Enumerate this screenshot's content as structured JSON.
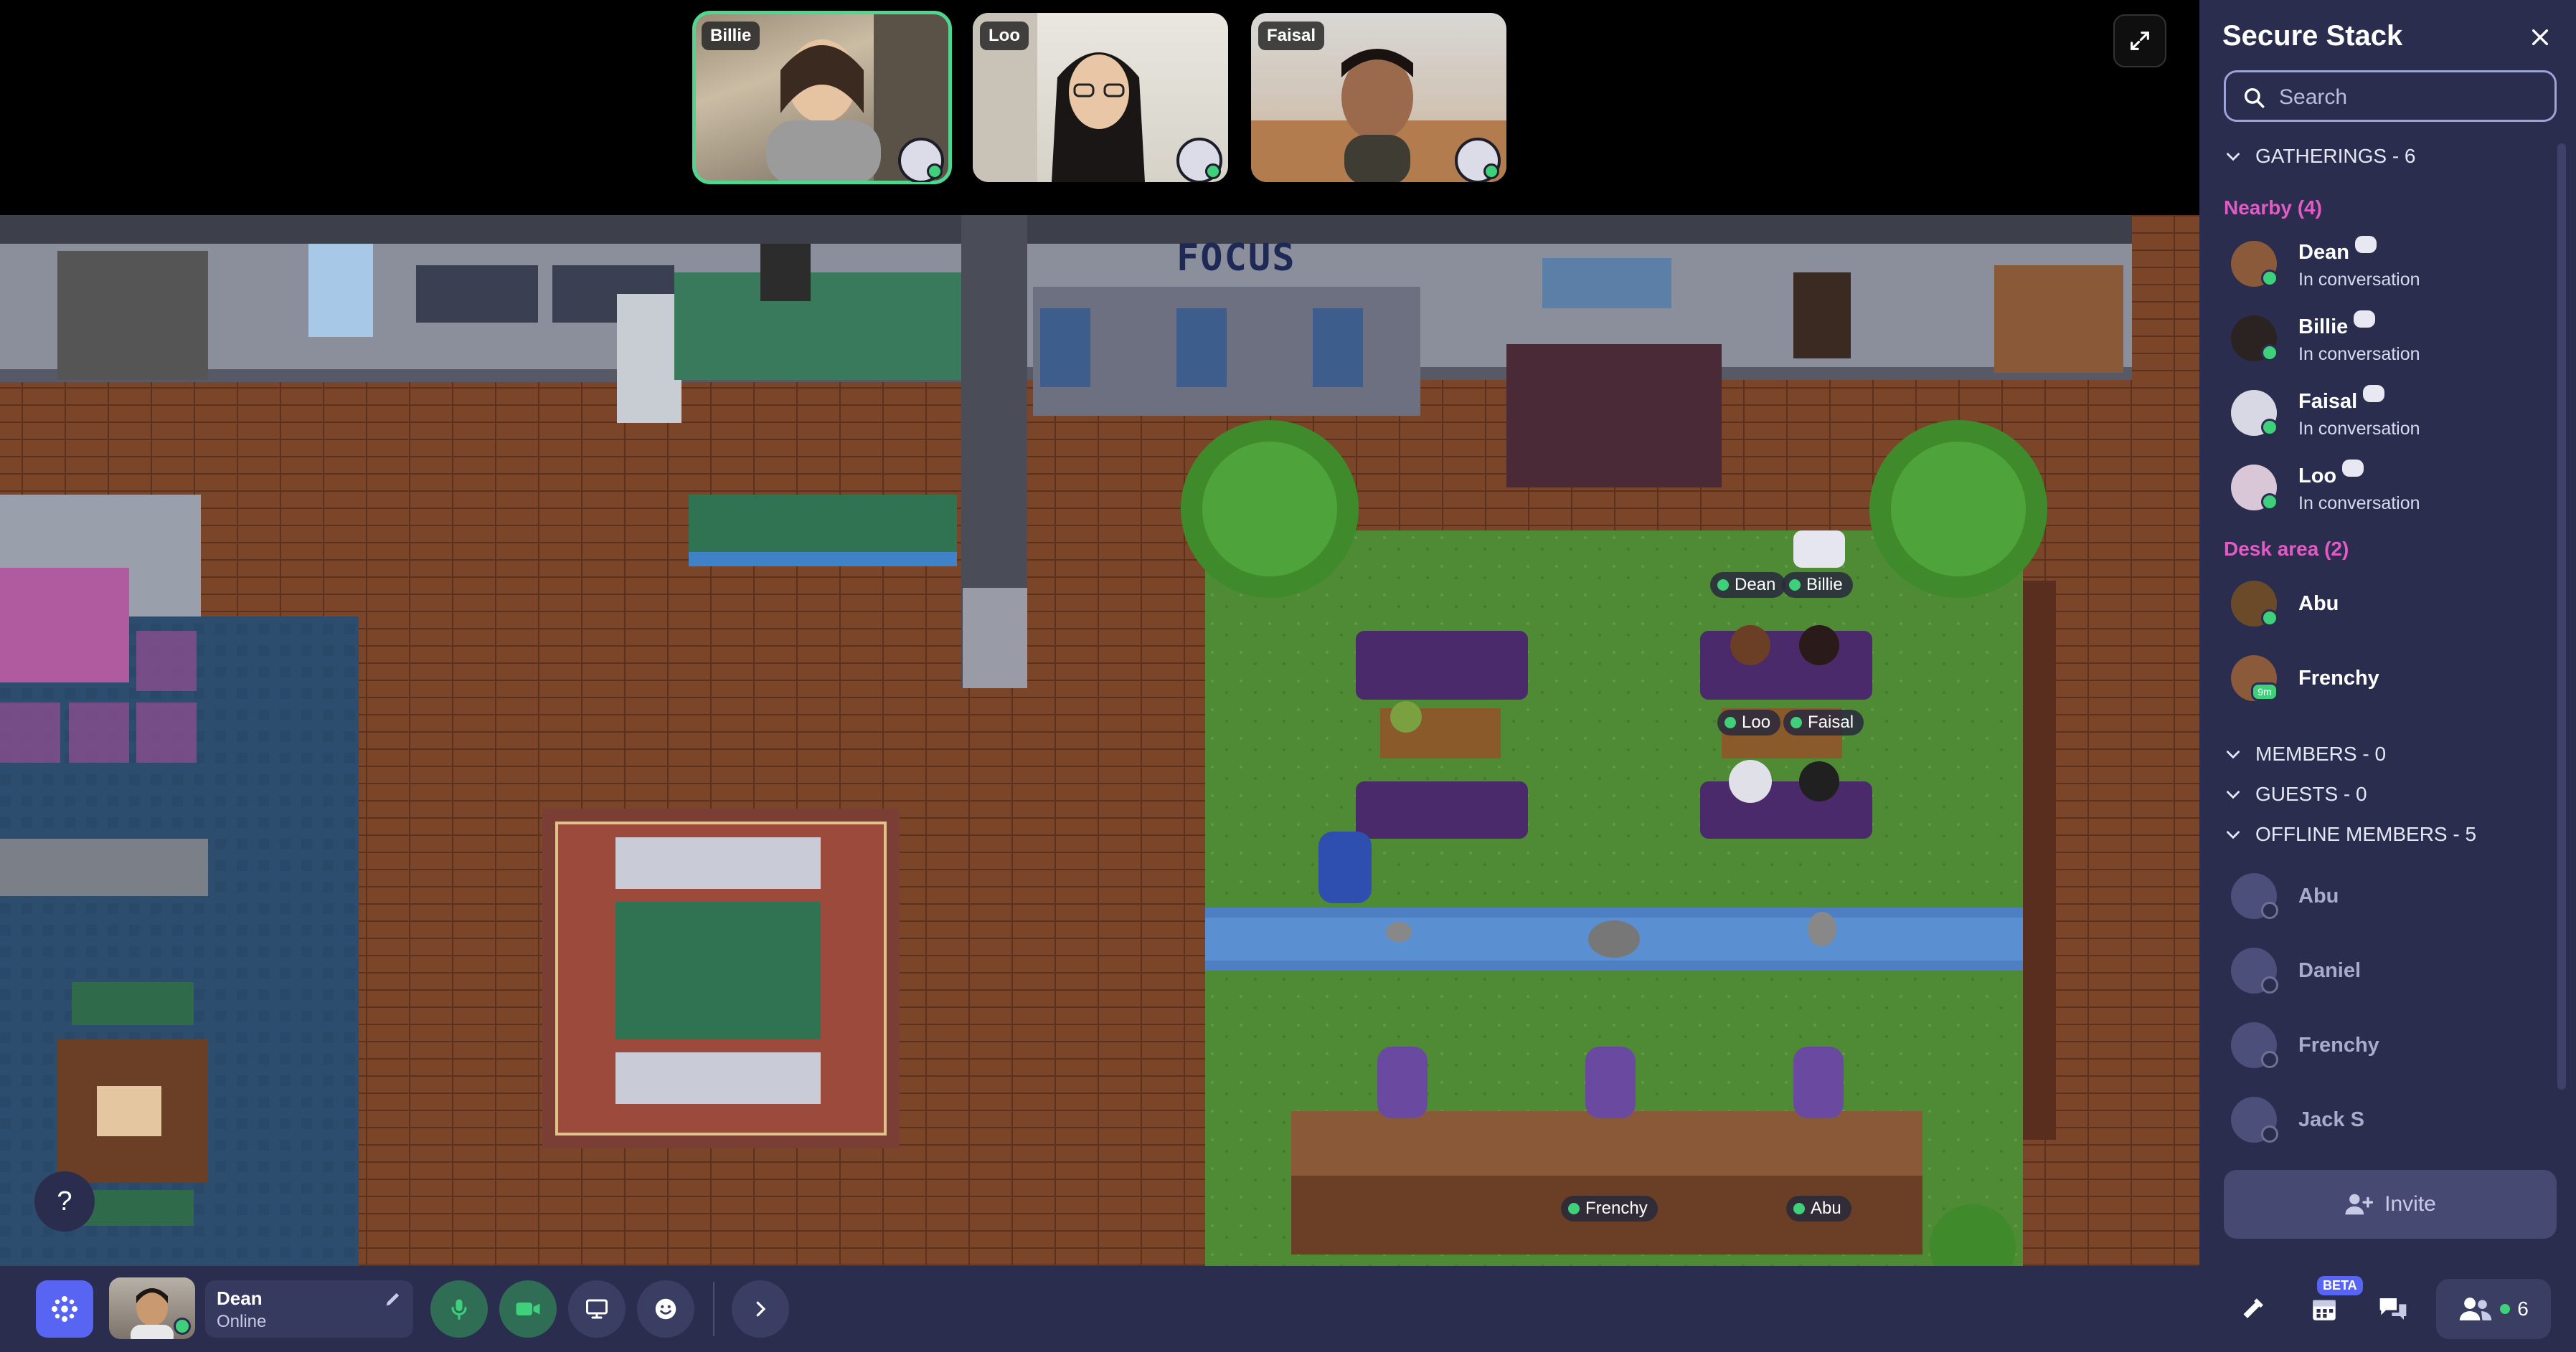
{
  "videos": [
    {
      "name": "Billie",
      "active": true
    },
    {
      "name": "Loo",
      "active": false
    },
    {
      "name": "Faisal",
      "active": false
    }
  ],
  "map": {
    "focus_sign": "FOCUS",
    "nametags": [
      "Dean",
      "Billie",
      "Loo",
      "Faisal",
      "Frenchy",
      "Abu"
    ],
    "help_label": "?"
  },
  "sidebar": {
    "title": "Secure Stack",
    "search_placeholder": "Search",
    "gatherings_header": "GATHERINGS - 6",
    "nearby_label": "Nearby (4)",
    "nearby": [
      {
        "name": "Dean",
        "status": "In conversation"
      },
      {
        "name": "Billie",
        "status": "In conversation"
      },
      {
        "name": "Faisal",
        "status": "In conversation"
      },
      {
        "name": "Loo",
        "status": "In conversation"
      }
    ],
    "desk_label": "Desk area (2)",
    "desk": [
      {
        "name": "Abu"
      },
      {
        "name": "Frenchy",
        "badge": "9m"
      }
    ],
    "members_header": "MEMBERS - 0",
    "guests_header": "GUESTS - 0",
    "offline_header": "OFFLINE MEMBERS - 5",
    "offline": [
      "Abu",
      "Daniel",
      "Frenchy",
      "Jack S"
    ],
    "invite_label": "Invite"
  },
  "bottom_bar": {
    "user_name": "Dean",
    "user_status": "Online",
    "calendar_badge": "BETA",
    "participants_count": "6"
  },
  "colors": {
    "sidebar_bg": "#2a2d4e",
    "accent_green": "#3ed07a",
    "group_label": "#e05cc4",
    "brand_blue": "#5865f2"
  }
}
